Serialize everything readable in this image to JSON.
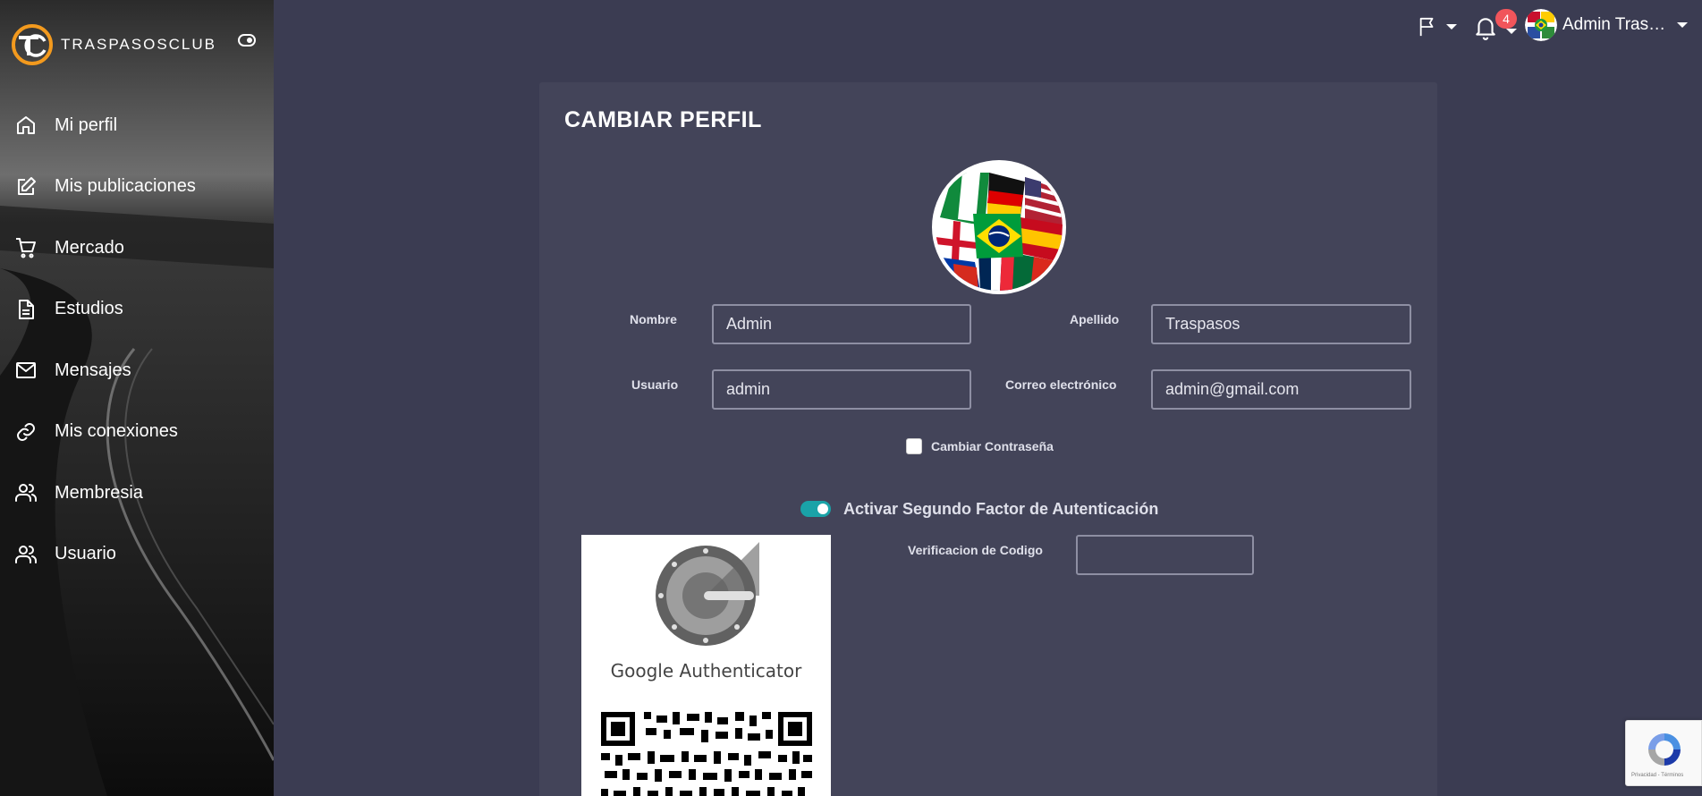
{
  "brand": {
    "name": "TRASPASOSCLUB",
    "logo_letters": "TC"
  },
  "sidebar": {
    "items": [
      {
        "label": "Mi perfil",
        "icon": "home-icon"
      },
      {
        "label": "Mis publicaciones",
        "icon": "edit-icon"
      },
      {
        "label": "Mercado",
        "icon": "cart-icon"
      },
      {
        "label": "Estudios",
        "icon": "document-icon"
      },
      {
        "label": "Mensajes",
        "icon": "mail-icon"
      },
      {
        "label": "Mis conexiones",
        "icon": "link-icon"
      },
      {
        "label": "Membresia",
        "icon": "users-icon"
      },
      {
        "label": "Usuario",
        "icon": "users-icon"
      }
    ]
  },
  "topbar": {
    "notifications_count": "4",
    "user_name": "Admin Traspasos"
  },
  "card": {
    "title": "CAMBIAR PERFIL",
    "fields": {
      "nombre": {
        "label": "Nombre",
        "value": "Admin"
      },
      "apellido": {
        "label": "Apellido",
        "value": "Traspasos"
      },
      "usuario": {
        "label": "Usuario",
        "value": "admin"
      },
      "correo": {
        "label": "Correo electrónico",
        "value": "admin@gmail.com"
      }
    },
    "change_password_label": "Cambiar Contraseña",
    "two_factor_label": "Activar Segundo Factor de Autenticación",
    "two_factor_enabled": true,
    "verification_label": "Verificacion de Codigo",
    "verification_value": "",
    "authenticator_name": "Google Authenticator"
  },
  "recaptcha": {
    "text": "Privacidad - Términos"
  },
  "colors": {
    "background": "#3b3c52",
    "card": "#434459",
    "accent": "#1aa3a8",
    "badge": "#f1555b",
    "logo_orange": "#f39a1e"
  }
}
